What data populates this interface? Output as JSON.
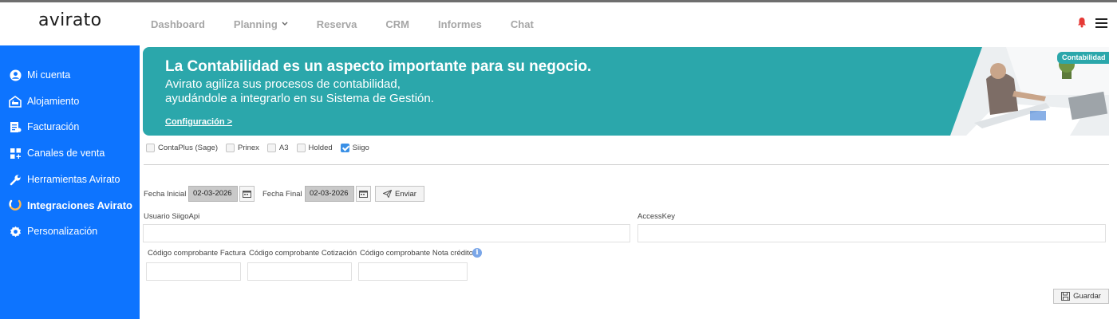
{
  "app": {
    "logo": "avirato"
  },
  "nav": [
    {
      "label": "Dashboard"
    },
    {
      "label": "Planning",
      "has_dropdown": true
    },
    {
      "label": "Reserva"
    },
    {
      "label": "CRM"
    },
    {
      "label": "Informes"
    },
    {
      "label": "Chat"
    }
  ],
  "sidebar": {
    "items": [
      {
        "label": "Mi cuenta",
        "icon": "account-icon"
      },
      {
        "label": "Alojamiento",
        "icon": "hotel-icon"
      },
      {
        "label": "Facturación",
        "icon": "invoice-icon"
      },
      {
        "label": "Canales de venta",
        "icon": "channels-icon"
      },
      {
        "label": "Herramientas Avirato",
        "icon": "wrench-icon"
      },
      {
        "label": "Integraciones Avirato",
        "icon": "integrations-icon",
        "active": true
      },
      {
        "label": "Personalización",
        "icon": "gear-icon"
      }
    ]
  },
  "banner": {
    "title": "La Contabilidad es un aspecto importante para su negocio.",
    "line1": "Avirato agiliza sus procesos de contabilidad,",
    "line2": "ayudándole a integrarlo en su Sistema de Gestión.",
    "link": "Configuración >",
    "tag": "Contabilidad",
    "color": "#2ba7ab"
  },
  "integrations": [
    {
      "label": "ContaPlus (Sage)",
      "checked": false
    },
    {
      "label": "Prinex",
      "checked": false
    },
    {
      "label": "A3",
      "checked": false
    },
    {
      "label": "Holded",
      "checked": false
    },
    {
      "label": "Siigo",
      "checked": true
    }
  ],
  "form": {
    "fecha_inicial_label": "Fecha Inicial",
    "fecha_inicial_value": "02-03-2026",
    "fecha_final_label": "Fecha Final",
    "fecha_final_value": "02-03-2026",
    "send_label": "Enviar",
    "usuario_label": "Usuario SiigoApi",
    "usuario_value": "",
    "accesskey_label": "AccessKey",
    "accesskey_value": "",
    "cod_factura_label": "Código comprobante Factura",
    "cod_cotizacion_label": "Código comprobante Cotización",
    "cod_nota_label": "Código comprobante Nota crédito",
    "save_label": "Guardar"
  },
  "colors": {
    "sidebar": "#0d74ff",
    "accent": "#3a90e6",
    "bell": "#e53935"
  }
}
